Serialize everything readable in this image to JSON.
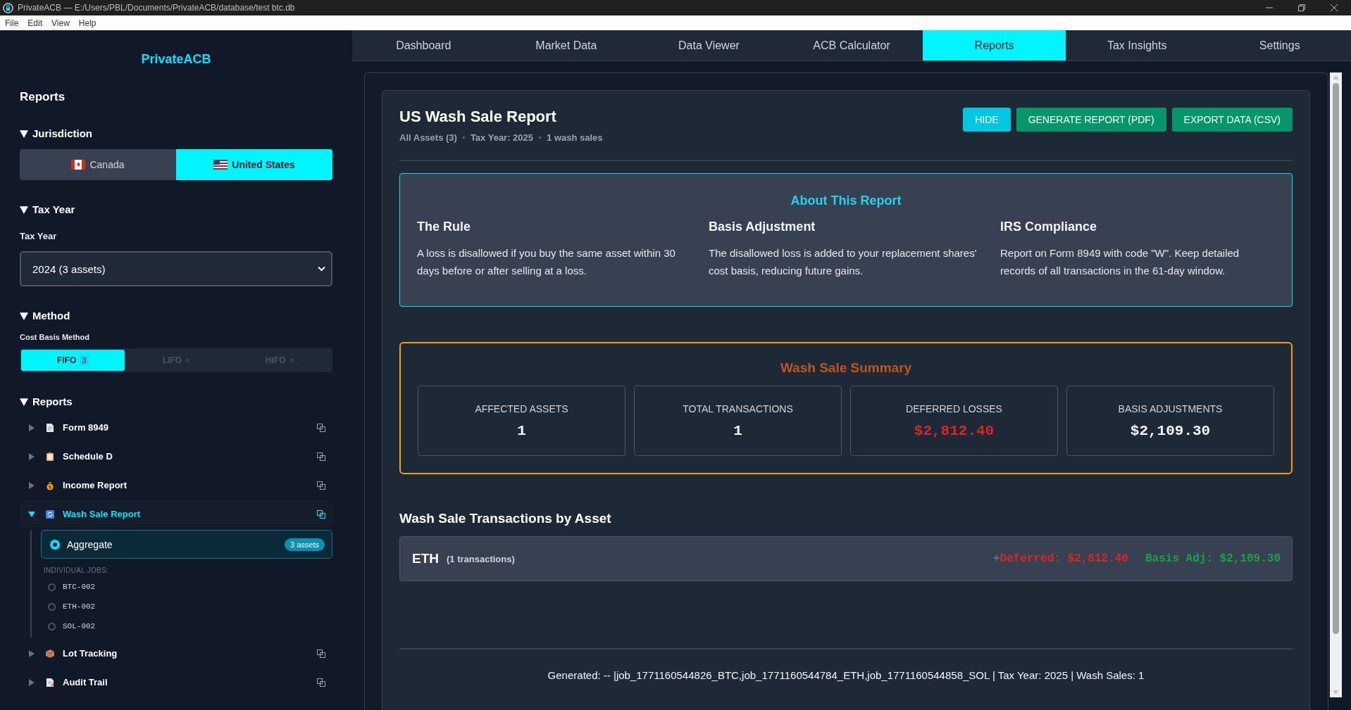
{
  "window": {
    "title": "PrivateACB — E:/Users/PBL/Documents/PrivateACB/database/test btc.db"
  },
  "menu": [
    "File",
    "Edit",
    "View",
    "Help"
  ],
  "sidebar": {
    "brand": "PrivateACB",
    "heading": "Reports",
    "jurisdiction": {
      "title": "Jurisdiction",
      "options": [
        {
          "label": "Canada",
          "selected": false
        },
        {
          "label": "United States",
          "selected": true
        }
      ]
    },
    "tax_year": {
      "title": "Tax Year",
      "label": "Tax Year",
      "value": "2024 (3 assets)"
    },
    "method": {
      "title": "Method",
      "label": "Cost Basis Method",
      "options": [
        {
          "label": "FIFO",
          "badge": "3",
          "selected": true
        },
        {
          "label": "LIFO",
          "selected": false
        },
        {
          "label": "HIFO",
          "selected": false
        }
      ]
    },
    "reports": {
      "title": "Reports",
      "items": [
        {
          "label": "Form 8949",
          "expanded": false,
          "selected": false
        },
        {
          "label": "Schedule D",
          "expanded": false,
          "selected": false
        },
        {
          "label": "Income Report",
          "expanded": false,
          "selected": false
        },
        {
          "label": "Wash Sale Report",
          "expanded": true,
          "selected": true,
          "aggregate": {
            "label": "Aggregate",
            "badge": "3 assets",
            "selected": true
          },
          "jobs_label": "INDIVIDUAL JOBS:",
          "jobs": [
            {
              "label": "BTC-002",
              "selected": false
            },
            {
              "label": "ETH-002",
              "selected": false
            },
            {
              "label": "SOL-002",
              "selected": false
            }
          ]
        },
        {
          "label": "Lot Tracking",
          "expanded": false,
          "selected": false
        },
        {
          "label": "Audit Trail",
          "expanded": false,
          "selected": false
        }
      ]
    }
  },
  "tabs": [
    {
      "label": "Dashboard",
      "selected": false
    },
    {
      "label": "Market Data",
      "selected": false
    },
    {
      "label": "Data Viewer",
      "selected": false
    },
    {
      "label": "ACB Calculator",
      "selected": false
    },
    {
      "label": "Reports",
      "selected": true
    },
    {
      "label": "Tax Insights",
      "selected": false
    },
    {
      "label": "Settings",
      "selected": false
    }
  ],
  "report": {
    "title": "US Wash Sale Report",
    "meta": [
      "All Assets (3)",
      "Tax Year: 2025",
      "1 wash sales"
    ],
    "buttons": [
      {
        "label": "HIDE",
        "kind": "secondary"
      },
      {
        "label": "GENERATE REPORT (PDF)",
        "kind": "primary"
      },
      {
        "label": "EXPORT DATA (CSV)",
        "kind": "primary"
      }
    ],
    "about": {
      "title": "About This Report",
      "columns": [
        {
          "heading": "The Rule",
          "text": "A loss is disallowed if you buy the same asset within 30 days before or after selling at a loss."
        },
        {
          "heading": "Basis Adjustment",
          "text": "The disallowed loss is added to your replacement shares' cost basis, reducing future gains."
        },
        {
          "heading": "IRS Compliance",
          "text": "Report on Form 8949 with code \"W\". Keep detailed records of all transactions in the 61-day window."
        }
      ]
    },
    "summary": {
      "title": "Wash Sale Summary",
      "stats": [
        {
          "label": "AFFECTED ASSETS",
          "value": "1",
          "color": "#f3f4f6"
        },
        {
          "label": "TOTAL TRANSACTIONS",
          "value": "1",
          "color": "#f3f4f6"
        },
        {
          "label": "DEFERRED LOSSES",
          "value": "$2,812.40",
          "color": "#dc2626"
        },
        {
          "label": "BASIS ADJUSTMENTS",
          "value": "$2,109.30",
          "color": "#f3f4f6"
        }
      ]
    },
    "transactions": {
      "title": "Wash Sale Transactions by Asset",
      "rows": [
        {
          "asset": "ETH",
          "count": "(1 transactions)",
          "toggle": "+",
          "deferred": "Deferred: $2,812.40",
          "basis_adj": "Basis Adj: $2,109.30"
        }
      ]
    },
    "footer": "Generated: -- |job_1771160544826_BTC,job_1771160544784_ETH,job_1771160544858_SOL | Tax Year: 2025 | Wash Sales: 1"
  }
}
